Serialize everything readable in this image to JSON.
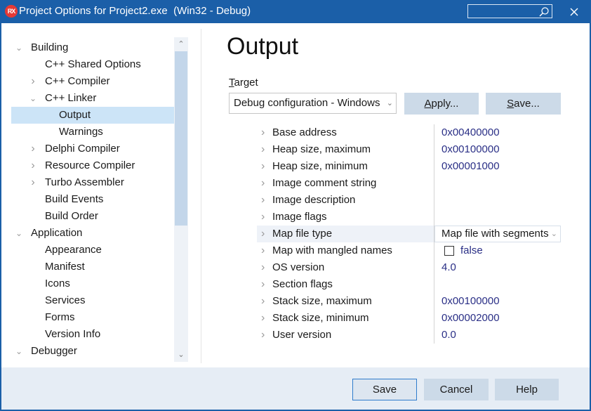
{
  "window": {
    "title": "Project Options for Project2.exe  (Win32 - Debug)",
    "app_icon_text": "RX",
    "search_placeholder": "",
    "close_label": "×"
  },
  "tree": {
    "items": [
      {
        "label": "Building",
        "level": 0,
        "expander": "expanded"
      },
      {
        "label": "C++ Shared Options",
        "level": 1,
        "expander": "none"
      },
      {
        "label": "C++ Compiler",
        "level": 1,
        "expander": "collapsed"
      },
      {
        "label": "C++ Linker",
        "level": 1,
        "expander": "expanded"
      },
      {
        "label": "Output",
        "level": 2,
        "expander": "none",
        "selected": true
      },
      {
        "label": "Warnings",
        "level": 2,
        "expander": "none"
      },
      {
        "label": "Delphi Compiler",
        "level": 1,
        "expander": "collapsed"
      },
      {
        "label": "Resource Compiler",
        "level": 1,
        "expander": "collapsed"
      },
      {
        "label": "Turbo Assembler",
        "level": 1,
        "expander": "collapsed"
      },
      {
        "label": "Build Events",
        "level": 1,
        "expander": "none"
      },
      {
        "label": "Build Order",
        "level": 1,
        "expander": "none"
      },
      {
        "label": "Application",
        "level": 0,
        "expander": "expanded"
      },
      {
        "label": "Appearance",
        "level": 1,
        "expander": "none"
      },
      {
        "label": "Manifest",
        "level": 1,
        "expander": "none"
      },
      {
        "label": "Icons",
        "level": 1,
        "expander": "none"
      },
      {
        "label": "Services",
        "level": 1,
        "expander": "none"
      },
      {
        "label": "Forms",
        "level": 1,
        "expander": "none"
      },
      {
        "label": "Version Info",
        "level": 1,
        "expander": "none"
      },
      {
        "label": "Debugger",
        "level": 0,
        "expander": "expanded"
      }
    ]
  },
  "main": {
    "title": "Output",
    "target_label_accel": "T",
    "target_label_rest": "arget",
    "target_value": "Debug configuration - Windows",
    "apply_accel": "A",
    "apply_rest": "pply...",
    "save_accel": "S",
    "save_rest": "ave..."
  },
  "properties": [
    {
      "name": "Base address",
      "value": "0x00400000"
    },
    {
      "name": "Heap size, maximum",
      "value": "0x00100000"
    },
    {
      "name": "Heap size, minimum",
      "value": "0x00001000"
    },
    {
      "name": "Image comment string",
      "value": ""
    },
    {
      "name": "Image description",
      "value": ""
    },
    {
      "name": "Image flags",
      "value": ""
    },
    {
      "name": "Map file type",
      "value": "Map file with segments",
      "editor": "combo"
    },
    {
      "name": "Map with mangled names",
      "value": "false",
      "editor": "checkbox",
      "checked": false
    },
    {
      "name": "OS version",
      "value": "4.0"
    },
    {
      "name": "Section flags",
      "value": ""
    },
    {
      "name": "Stack size, maximum",
      "value": "0x00100000"
    },
    {
      "name": "Stack size, minimum",
      "value": "0x00002000"
    },
    {
      "name": "User version",
      "value": "0.0"
    }
  ],
  "footer": {
    "save": "Save",
    "cancel": "Cancel",
    "help": "Help"
  },
  "colors": {
    "titlebar": "#1b5fa8",
    "selection": "#cce4f7",
    "button": "#ccdae8",
    "value_text": "#2a2f86",
    "footer_bg": "#e6edf5"
  }
}
